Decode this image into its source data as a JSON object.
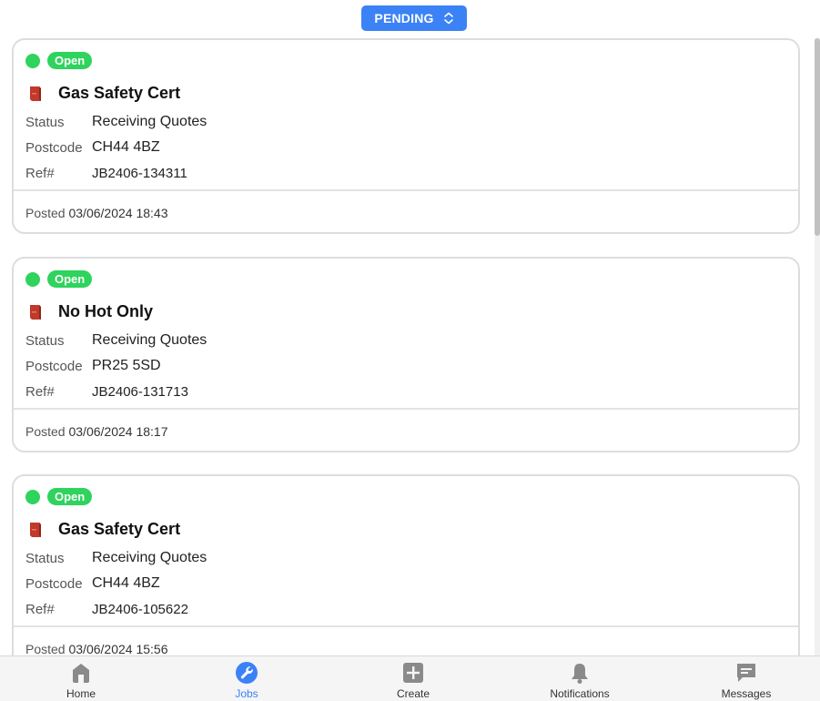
{
  "filter": {
    "label": "PENDING",
    "icon": "chevron-up-down-icon"
  },
  "jobs": [
    {
      "status_badge": "Open",
      "title": "Gas Safety Cert",
      "icon": "boiler-icon",
      "fields": {
        "status_label": "Status",
        "status_value": "Receiving Quotes",
        "postcode_label": "Postcode",
        "postcode_value": "CH44 4BZ",
        "ref_label": "Ref#",
        "ref_value": "JB2406-134311"
      },
      "posted_label": "Posted",
      "posted_date": "03/06/2024 18:43"
    },
    {
      "status_badge": "Open",
      "title": "No Hot Only",
      "icon": "boiler-icon",
      "fields": {
        "status_label": "Status",
        "status_value": "Receiving Quotes",
        "postcode_label": "Postcode",
        "postcode_value": "PR25 5SD",
        "ref_label": "Ref#",
        "ref_value": "JB2406-131713"
      },
      "posted_label": "Posted",
      "posted_date": "03/06/2024 18:17"
    },
    {
      "status_badge": "Open",
      "title": "Gas Safety Cert",
      "icon": "boiler-icon",
      "fields": {
        "status_label": "Status",
        "status_value": "Receiving Quotes",
        "postcode_label": "Postcode",
        "postcode_value": "CH44 4BZ",
        "ref_label": "Ref#",
        "ref_value": "JB2406-105622"
      },
      "posted_label": "Posted",
      "posted_date": "03/06/2024 15:56"
    }
  ],
  "nav": [
    {
      "label": "Home",
      "icon": "home-icon",
      "active": false
    },
    {
      "label": "Jobs",
      "icon": "wrench-icon",
      "active": true
    },
    {
      "label": "Create",
      "icon": "plus-icon",
      "active": false
    },
    {
      "label": "Notifications",
      "icon": "bell-icon",
      "active": false
    },
    {
      "label": "Messages",
      "icon": "message-icon",
      "active": false
    }
  ],
  "colors": {
    "accent": "#3b82f6",
    "open_green": "#2fd35d",
    "boiler_red": "#c0392b",
    "nav_icon_gray": "#8a8a8a"
  }
}
